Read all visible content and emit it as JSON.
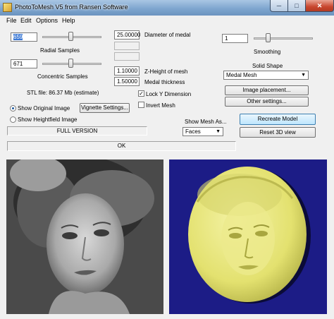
{
  "window": {
    "title": "PhotoToMesh V5 from Ransen Software",
    "min": "─",
    "max": "□",
    "close": "✕"
  },
  "menu": [
    "File",
    "Edit",
    "Options",
    "Help"
  ],
  "radial_samples": {
    "value": "659",
    "label": "Radial Samples"
  },
  "concentric_samples": {
    "value": "671",
    "label": "Concentric Samples"
  },
  "stl_file": "STL file: 86.37 Mb (estimate)",
  "diameter": {
    "value": "25.00000",
    "label": "Diameter of medal"
  },
  "z_height": {
    "value": "1.10000",
    "label": "Z-Height of mesh"
  },
  "medal_thickness": {
    "value": "1.50000",
    "label": "Medal thickness"
  },
  "lock_y": {
    "label": "Lock Y Dimension",
    "checked": true,
    "mark": "✓"
  },
  "invert_mesh": {
    "label": "Invert Mesh",
    "checked": false
  },
  "show_original": {
    "label": "Show Original Image",
    "selected": true
  },
  "show_heightfield": {
    "label": "Show Heightfield Image",
    "selected": false
  },
  "vignette_button": "Vignette Settings...",
  "full_version": "FULL VERSION",
  "status": "OK",
  "show_mesh_as": {
    "label": "Show Mesh As...",
    "value": "Faces"
  },
  "smoothing": {
    "value": "1",
    "label": "Smoothing"
  },
  "solid_shape": {
    "label": "Solid Shape",
    "value": "Medal Mesh"
  },
  "image_placement_button": "Image placement...",
  "other_settings_button": "Other settings...",
  "recreate_model_button": "Recreate Model",
  "reset_view_button": "Reset 3D view",
  "colors": {
    "mesh_background": "#1c1c86",
    "medal": "#e8e67a",
    "titlebar": "#7fa6cf"
  },
  "icons": {
    "dropdown": "▼"
  }
}
